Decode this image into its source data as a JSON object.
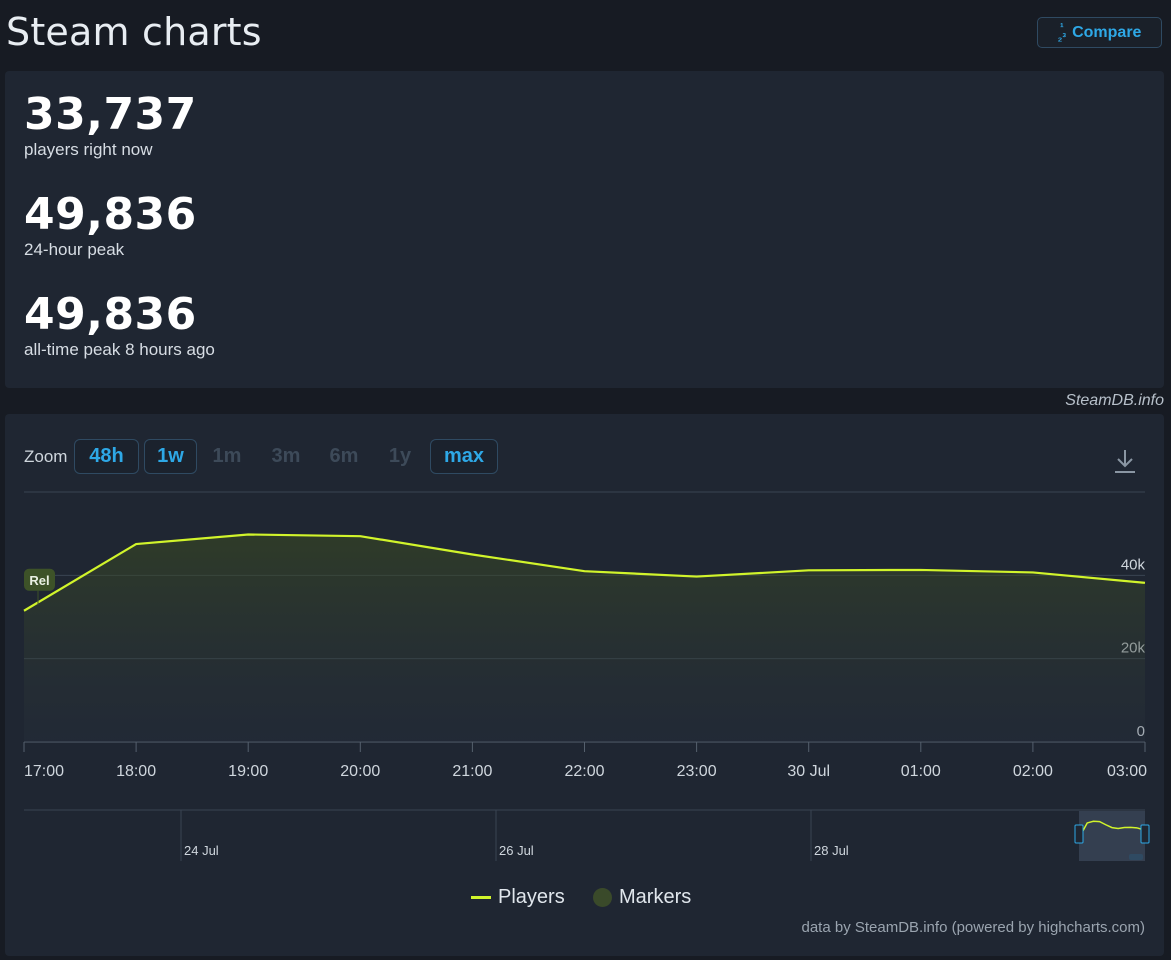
{
  "page": {
    "title": "Steam charts",
    "compare_label": "Compare",
    "compare_icon": "1/2/3"
  },
  "stats": [
    {
      "value": "33,737",
      "label": "players right now"
    },
    {
      "value": "49,836",
      "label": "24-hour peak"
    },
    {
      "value": "49,836",
      "label": "all-time peak 8 hours ago"
    }
  ],
  "credit_top": "SteamDB.info",
  "zoom": {
    "label": "Zoom",
    "options": [
      {
        "label": "48h",
        "state": "active"
      },
      {
        "label": "1w",
        "state": "active"
      },
      {
        "label": "1m",
        "state": "disabled"
      },
      {
        "label": "3m",
        "state": "disabled"
      },
      {
        "label": "6m",
        "state": "disabled"
      },
      {
        "label": "1y",
        "state": "disabled"
      },
      {
        "label": "max",
        "state": "active"
      }
    ]
  },
  "chart_data": {
    "type": "area",
    "ylim": [
      0,
      60000
    ],
    "y_ticks": [
      0,
      20000,
      40000
    ],
    "y_tick_labels": [
      "0",
      "20k",
      "40k"
    ],
    "x_tick_labels": [
      "17:00",
      "18:00",
      "19:00",
      "20:00",
      "21:00",
      "22:00",
      "23:00",
      "30 Jul",
      "01:00",
      "02:00",
      "03:00"
    ],
    "series": [
      {
        "name": "Players",
        "values": [
          31500,
          47500,
          49800,
          49400,
          45000,
          41000,
          39700,
          41200,
          41300,
          40700,
          38200
        ]
      }
    ],
    "marker": {
      "label": "Rel",
      "at_index": 0
    },
    "navigator_labels": [
      "24 Jul",
      "26 Jul",
      "28 Jul"
    ],
    "colors": {
      "line": "#d1f42b",
      "grid": "#3a4452",
      "axis_text": "#cfd6dd"
    },
    "legend": [
      {
        "name": "Players"
      },
      {
        "name": "Markers"
      }
    ]
  },
  "credit_bottom": "data by SteamDB.info (powered by highcharts.com)"
}
